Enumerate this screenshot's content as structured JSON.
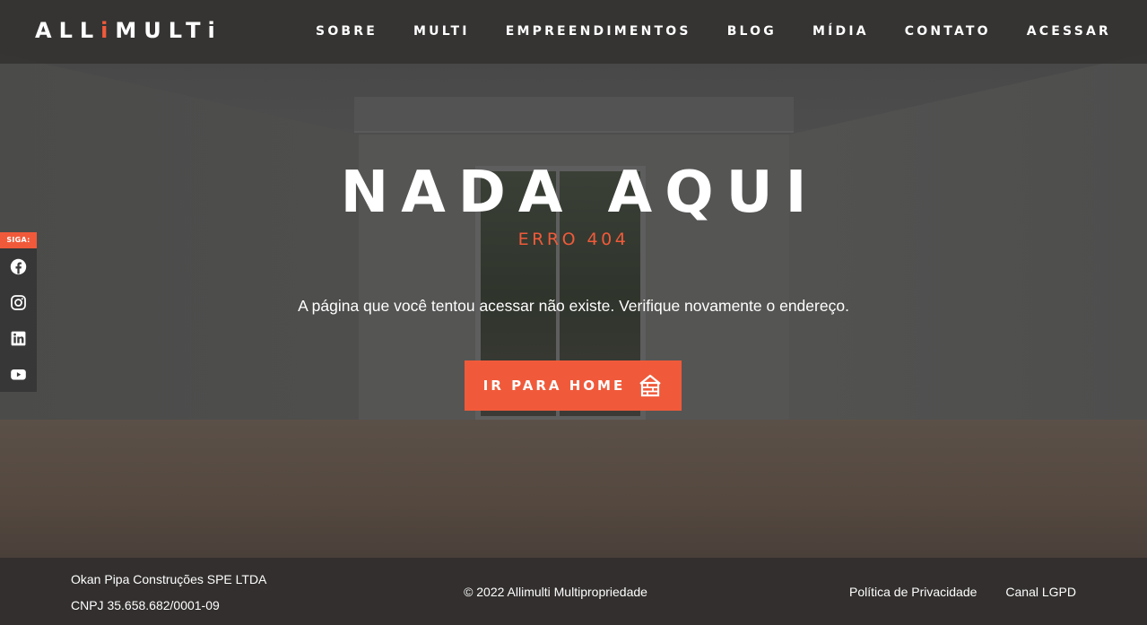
{
  "header": {
    "logo": {
      "prefix": "ALL",
      "i_char": "i",
      "suffix": "MULTi",
      "accent_color": "#f05a3a"
    },
    "nav": [
      "SOBRE",
      "MULTI",
      "EMPREENDIMENTOS",
      "BLOG",
      "MÍDIA",
      "CONTATO",
      "ACESSAR"
    ]
  },
  "social": {
    "label": "SIGA:",
    "icons": [
      "facebook-icon",
      "instagram-icon",
      "linkedin-icon",
      "youtube-icon"
    ]
  },
  "main": {
    "title": "NADA AQUI",
    "subtitle": "ERRO 404",
    "description": "A página que você tentou acessar não existe. Verifique novamente o endereço.",
    "button_label": "IR PARA HOME",
    "button_icon": "house-icon",
    "accent_color": "#f05a3a"
  },
  "footer": {
    "company": "Okan Pipa Construções SPE LTDA",
    "cnpj": "CNPJ 35.658.682/0001-09",
    "copyright": "© 2022 Allimulti Multipropriedade",
    "links": [
      "Política de Privacidade",
      "Canal LGPD"
    ]
  }
}
